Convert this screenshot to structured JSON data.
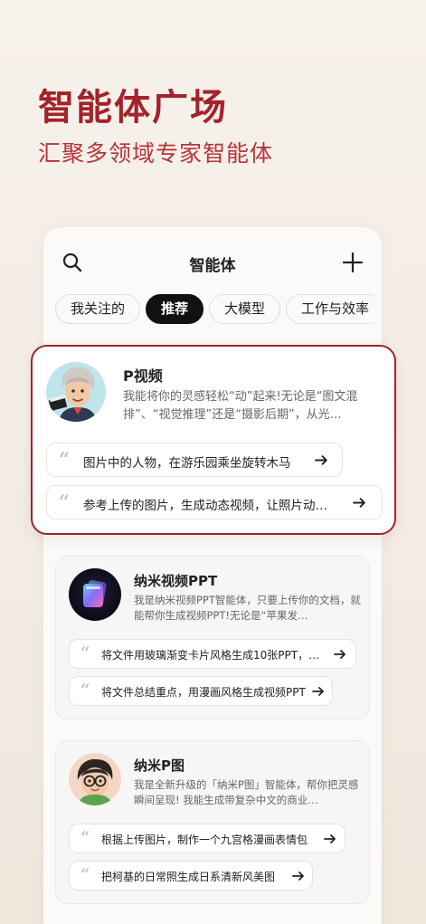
{
  "hero": {
    "title": "智能体广场",
    "subtitle": "汇聚多领域专家智能体"
  },
  "topbar": {
    "title": "智能体",
    "search_icon": "search-icon",
    "add_icon": "plus-icon"
  },
  "tabs": [
    "我关注的",
    "推荐",
    "大模型",
    "工作与效率"
  ],
  "active_tab": "推荐",
  "colors": {
    "brand": "#a3232a",
    "active_tab_bg": "#111111"
  },
  "agents": [
    {
      "name": "P视频",
      "desc": "我能将你的灵感轻松“动”起来!无论是“图文混排”、“视觉推理”还是“摄影后期”，从光…",
      "prompts": [
        "图片中的人物，在游乐园乘坐旋转木马",
        "参考上传的图片，生成动态视频，让照片动…"
      ]
    },
    {
      "name": "纳米视频PPT",
      "desc": "我是纳米视频PPT智能体，只要上传你的文档，就能帮你生成视频PPT!无论是“苹果发…",
      "prompts": [
        "将文件用玻璃渐变卡片风格生成10张PPT，…",
        "将文件总结重点，用漫画风格生成视频PPT"
      ]
    },
    {
      "name": "纳米P图",
      "desc": "我是全新升级的「纳米P图」智能体，帮你把灵感瞬间呈现! 我能生成带复杂中文的商业…",
      "prompts": [
        "根据上传图片，制作一个九宫格漫画表情包",
        "把柯基的日常照生成日系清新风美图"
      ]
    }
  ]
}
